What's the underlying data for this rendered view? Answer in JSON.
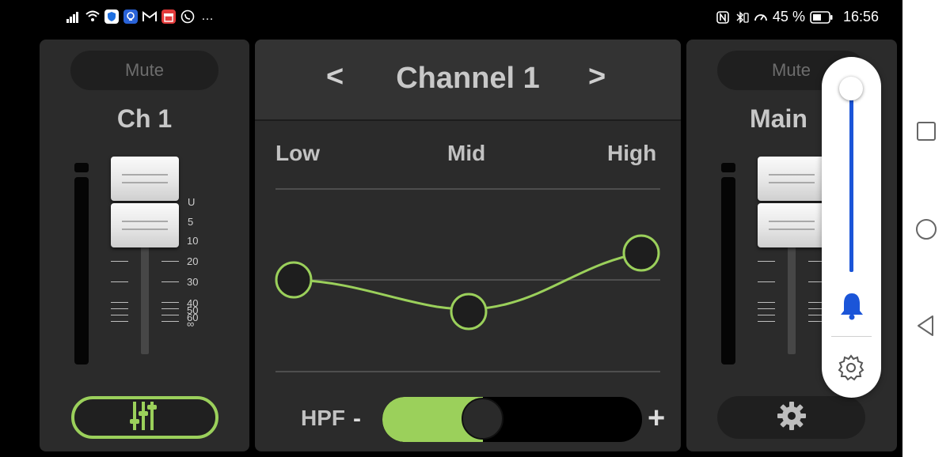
{
  "status_bar": {
    "battery_percent": "45 %",
    "time": "16:56",
    "more": "…"
  },
  "left_strip": {
    "mute_label": "Mute",
    "channel_label": "Ch 1",
    "scale": [
      "U",
      "5",
      "10",
      "20",
      "30",
      "40",
      "50",
      "60",
      "∞"
    ]
  },
  "center": {
    "prev_label": "<",
    "title": "Channel 1",
    "next_label": ">",
    "bands": {
      "low": "Low",
      "mid": "Mid",
      "high": "High"
    },
    "hpf": {
      "label": "HPF",
      "minus": "-",
      "plus": "+",
      "value": 0.28
    },
    "accent_color": "#9bd05b"
  },
  "right_strip": {
    "mute_label": "Mute",
    "channel_label": "Main"
  },
  "volume_popup": {
    "level": 0.95,
    "accent_color": "#1b55d8"
  }
}
